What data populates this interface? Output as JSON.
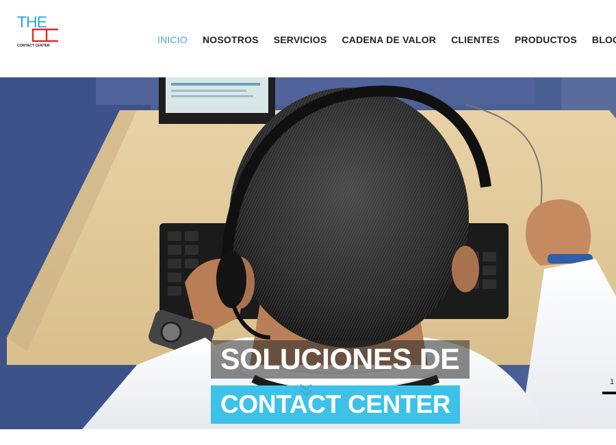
{
  "logo": {
    "line1": "THE",
    "line2": "CC",
    "tagline": "CONTACT CENTER",
    "colors": {
      "the": "#29a9e0",
      "cc": "#e8262b"
    }
  },
  "nav": {
    "items": [
      {
        "label": "INICIO",
        "active": true
      },
      {
        "label": "NOSOTROS",
        "active": false
      },
      {
        "label": "SERVICIOS",
        "active": false
      },
      {
        "label": "CADENA DE VALOR",
        "active": false
      },
      {
        "label": "CLIENTES",
        "active": false
      },
      {
        "label": "PRODUCTOS",
        "active": false
      },
      {
        "label": "BLOG",
        "active": false
      }
    ]
  },
  "hero": {
    "headline_line1": "SOLUCIONES DE",
    "headline_line2": "CONTACT CENTER",
    "slide_number": "1",
    "scroll_icon": "double-chevron-down-icon"
  },
  "colors": {
    "accent": "#3fa9d6",
    "highlight_bg": "#3cc2e8",
    "nav_text": "#222222"
  }
}
